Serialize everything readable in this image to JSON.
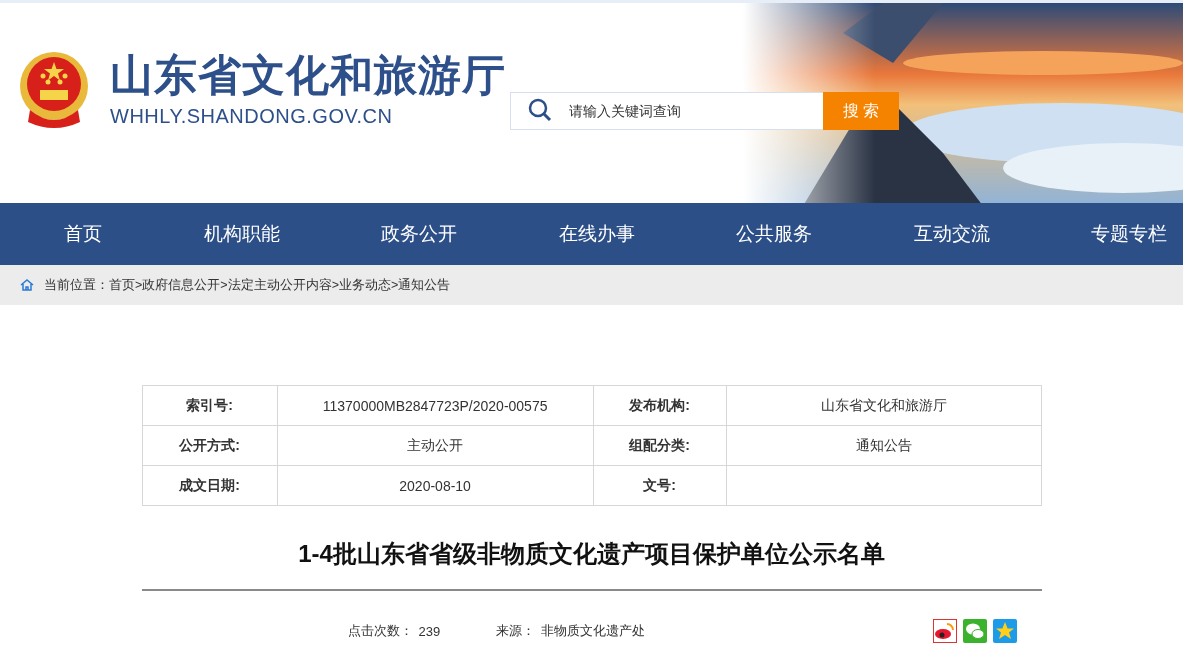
{
  "header": {
    "title": "山东省文化和旅游厅",
    "domain": "WHHLY.SHANDONG.GOV.CN",
    "search": {
      "placeholder": "请输入关键词查询",
      "button": "搜 索"
    }
  },
  "nav": [
    {
      "label": "首页"
    },
    {
      "label": "机构职能"
    },
    {
      "label": "政务公开"
    },
    {
      "label": "在线办事"
    },
    {
      "label": "公共服务"
    },
    {
      "label": "互动交流"
    },
    {
      "label": "专题专栏"
    }
  ],
  "breadcrumb": {
    "label": "当前位置：",
    "separator": ">",
    "items": [
      "首页",
      "政府信息公开",
      "法定主动公开内容",
      "业务动态",
      "通知公告"
    ]
  },
  "info_table": [
    [
      {
        "label": "索引号:",
        "value": "11370000MB2847723P/2020-00575"
      },
      {
        "label": "发布机构:",
        "value": "山东省文化和旅游厅"
      }
    ],
    [
      {
        "label": "公开方式:",
        "value": "主动公开"
      },
      {
        "label": "组配分类:",
        "value": "通知公告"
      }
    ],
    [
      {
        "label": "成文日期:",
        "value": "2020-08-10"
      },
      {
        "label": "文号:"
      }
    ]
  ],
  "article": {
    "title": "1-4批山东省省级非物质文化遗产项目保护单位公示名单",
    "clicks_label": "点击次数：",
    "clicks": "239",
    "source_label": "来源：",
    "source": "非物质文化遗产处"
  },
  "share": [
    {
      "kind": "weibo"
    },
    {
      "kind": "wechat"
    },
    {
      "kind": "qzone"
    }
  ]
}
